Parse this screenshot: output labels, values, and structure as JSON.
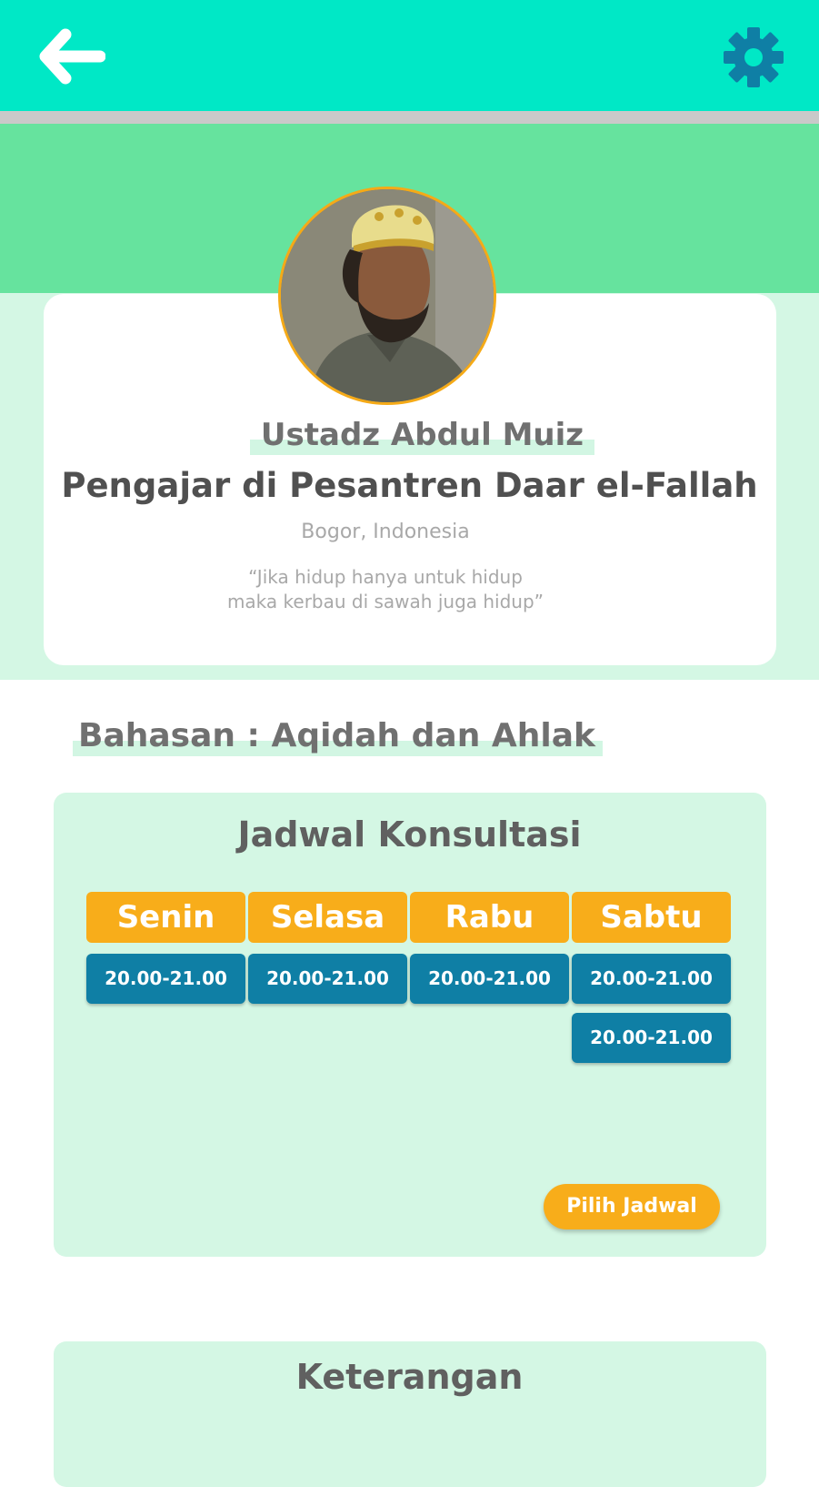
{
  "header": {
    "back_icon": "arrow-left-icon",
    "settings_icon": "gear-icon",
    "background_color": "#00e8c6"
  },
  "profile": {
    "name": "Ustadz Abdul Muiz",
    "title": "Pengajar di Pesantren Daar el-Fallah",
    "location": "Bogor, Indonesia",
    "quote_line1": "“Jika hidup hanya untuk hidup",
    "quote_line2": "maka kerbau di sawah juga hidup”"
  },
  "topic": {
    "label": "Bahasan : Aqidah dan Ahlak"
  },
  "schedule": {
    "title": "Jadwal Konsultasi",
    "days": [
      {
        "label": "Senin",
        "slots": [
          "20.00-21.00"
        ]
      },
      {
        "label": "Selasa",
        "slots": [
          "20.00-21.00"
        ]
      },
      {
        "label": "Rabu",
        "slots": [
          "20.00-21.00"
        ]
      },
      {
        "label": "Sabtu",
        "slots": [
          "20.00-21.00",
          "20.00-21.00"
        ]
      }
    ],
    "pick_button": "Pilih Jadwal"
  },
  "info": {
    "title": "Keterangan"
  },
  "colors": {
    "accent_orange": "#f8ad1a",
    "slot_blue": "#0f7fa5",
    "mint": "#d4f7e4",
    "hero_green": "#66e39e"
  }
}
